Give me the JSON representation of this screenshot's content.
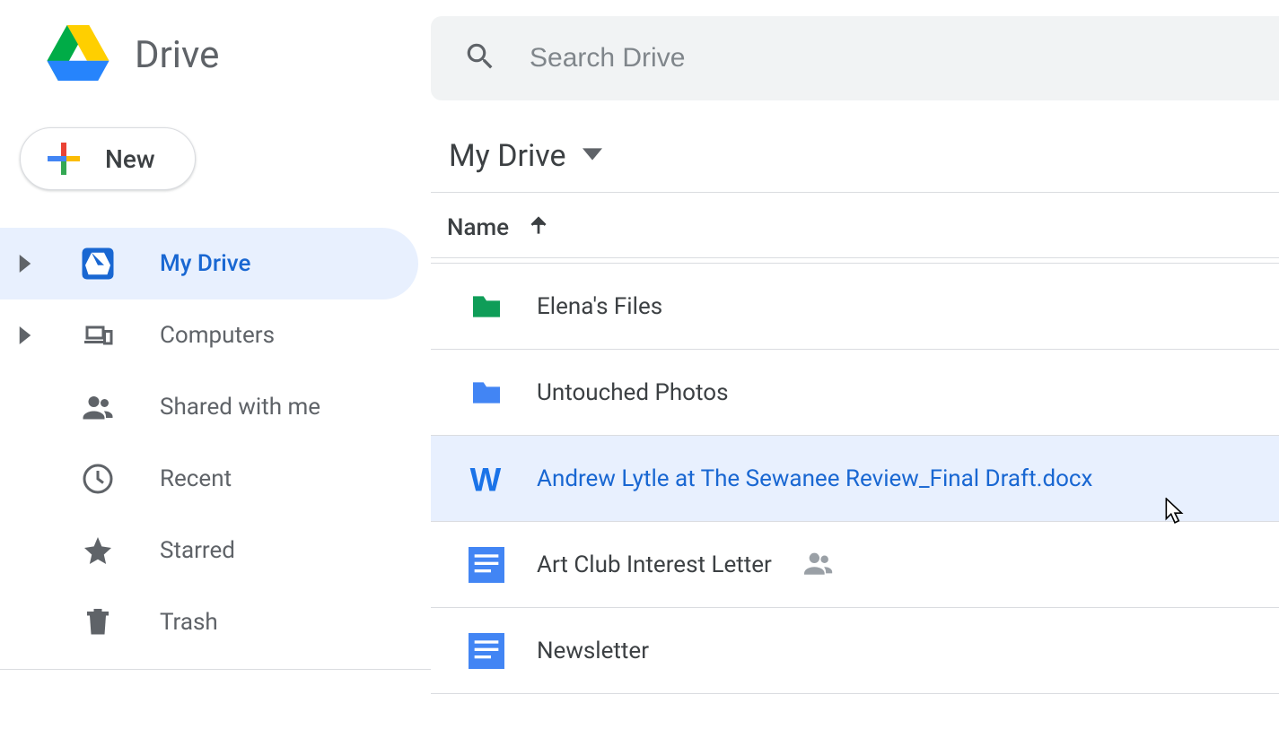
{
  "app_name": "Drive",
  "new_button_label": "New",
  "search": {
    "placeholder": "Search Drive"
  },
  "sidebar": {
    "items": [
      {
        "label": "My Drive",
        "icon": "drive-icon",
        "active": true,
        "expandable": true
      },
      {
        "label": "Computers",
        "icon": "computers-icon",
        "active": false,
        "expandable": true
      },
      {
        "label": "Shared with me",
        "icon": "shared-icon",
        "active": false,
        "expandable": false
      },
      {
        "label": "Recent",
        "icon": "clock-icon",
        "active": false,
        "expandable": false
      },
      {
        "label": "Starred",
        "icon": "star-icon",
        "active": false,
        "expandable": false
      },
      {
        "label": "Trash",
        "icon": "trash-icon",
        "active": false,
        "expandable": false
      }
    ]
  },
  "breadcrumb": {
    "label": "My Drive"
  },
  "list": {
    "sort_column": "Name",
    "sort_direction": "asc",
    "rows": [
      {
        "name": "Elena's Files",
        "type": "folder",
        "color": "#0f9d58",
        "shared": false,
        "selected": false
      },
      {
        "name": "Untouched Photos",
        "type": "folder",
        "color": "#4285f4",
        "shared": false,
        "selected": false
      },
      {
        "name": "Andrew Lytle at The Sewanee Review_Final Draft.docx",
        "type": "word",
        "color": "#1a73e8",
        "shared": false,
        "selected": true
      },
      {
        "name": "Art Club Interest Letter",
        "type": "gdoc",
        "color": "#4285f4",
        "shared": true,
        "selected": false
      },
      {
        "name": "Newsletter",
        "type": "gdoc",
        "color": "#4285f4",
        "shared": false,
        "selected": false
      }
    ]
  }
}
